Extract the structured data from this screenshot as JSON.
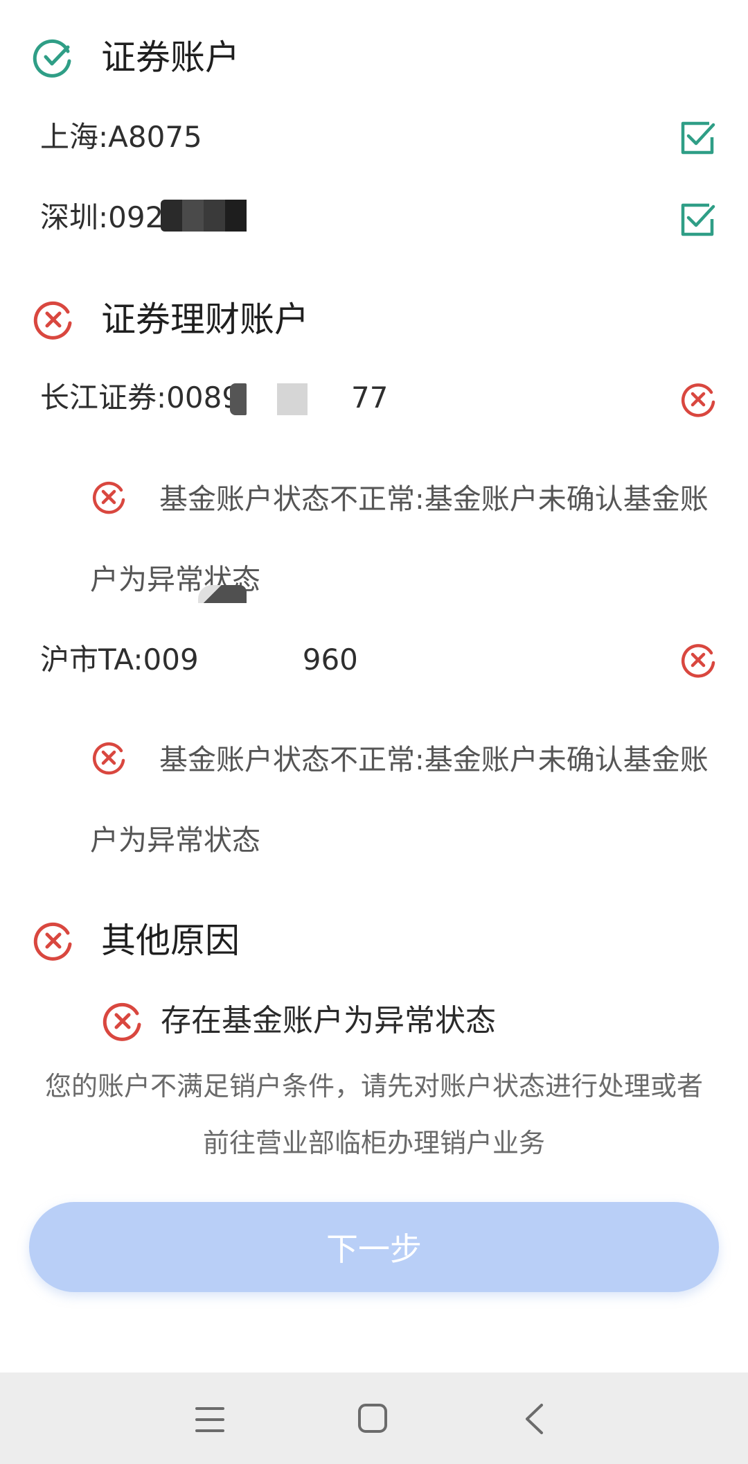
{
  "colors": {
    "success": "#2f9e86",
    "error": "#d9473f",
    "button_bg": "#b9cff7",
    "nav_bg": "#ededed"
  },
  "sections": {
    "securities": {
      "title": "证券账户",
      "status_icon": "check-circle-icon",
      "accounts": [
        {
          "label": "上海:A8075",
          "status_icon": "checked-box-icon"
        },
        {
          "label": "深圳:092",
          "status_icon": "checked-box-icon"
        }
      ]
    },
    "wealth": {
      "title": "证券理财账户",
      "status_icon": "x-circle-icon",
      "accounts": [
        {
          "label_prefix": "长江证券:0089",
          "label_suffix": "77",
          "status_icon": "x-circle-icon",
          "message": "基金账户状态不正常:基金账户未确认基金账户为异常状态"
        },
        {
          "label_prefix": "沪市TA:009",
          "label_suffix": "960",
          "status_icon": "x-circle-icon",
          "message": "基金账户状态不正常:基金账户未确认基金账户为异常状态"
        }
      ]
    },
    "other": {
      "title": "其他原因",
      "status_icon": "x-circle-icon",
      "reason": "存在基金账户为异常状态"
    }
  },
  "notice": "您的账户不满足销户条件，请先对账户状态进行处理或者前往营业部临柜办理销户业务",
  "next_button": "下一步",
  "nav": {
    "menu_icon": "menu-icon",
    "home_icon": "home-square-icon",
    "back_icon": "back-chevron-icon"
  }
}
